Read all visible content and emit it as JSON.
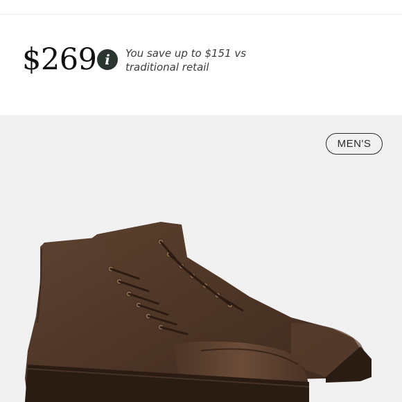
{
  "pricing": {
    "price": "$269",
    "savings_line1": "You save up to $151 vs",
    "savings_line2": "traditional retail",
    "info_icon": "info-icon"
  },
  "product": {
    "category_badge": "MEN'S",
    "image_subject": "brown-leather-cap-toe-lace-up-boots"
  },
  "colors": {
    "icon_bg": "#2b3530",
    "product_bg": "#f1f1f1",
    "leather": "#4a3426"
  }
}
